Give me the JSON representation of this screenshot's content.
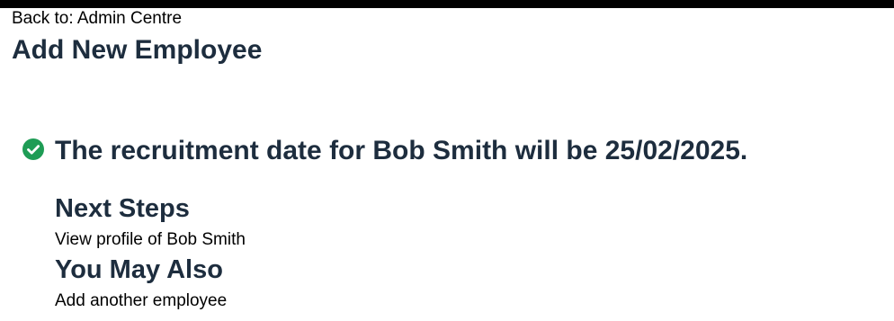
{
  "header": {
    "back_link": "Back to: Admin Centre",
    "title": "Add New Employee"
  },
  "confirmation": {
    "icon": "check-circle-icon",
    "icon_color": "#1e9c55",
    "message": "The recruitment date for Bob Smith will be 25/02/2025."
  },
  "next_steps": {
    "heading": "Next Steps",
    "links": [
      "View profile of Bob Smith"
    ]
  },
  "you_may_also": {
    "heading": "You May Also",
    "links": [
      "Add another employee"
    ]
  }
}
